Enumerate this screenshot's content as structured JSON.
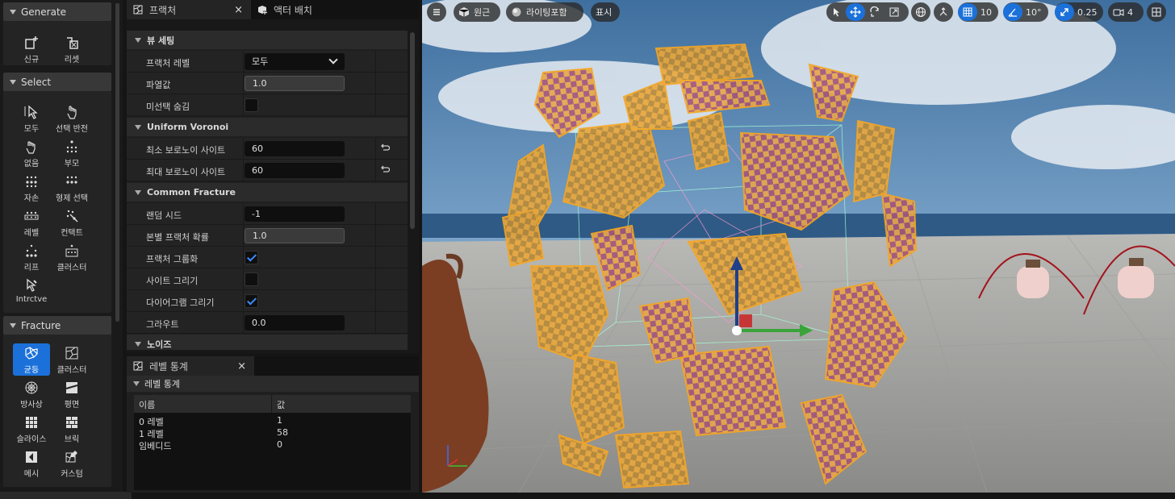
{
  "palette": {
    "sections": [
      {
        "title": "Generate",
        "tools": [
          {
            "label": "신규",
            "icon": "new-icon"
          },
          {
            "label": "리셋",
            "icon": "reset-icon"
          }
        ]
      },
      {
        "title": "Select",
        "tools": [
          {
            "label": "모두",
            "icon": "select-all-icon"
          },
          {
            "label": "선택 반전",
            "icon": "invert-selection-icon"
          },
          {
            "label": "없음",
            "icon": "select-none-icon"
          },
          {
            "label": "부모",
            "icon": "parent-icon"
          },
          {
            "label": "자손",
            "icon": "children-icon"
          },
          {
            "label": "형제 선택",
            "icon": "siblings-icon"
          },
          {
            "label": "레벨",
            "icon": "level-icon"
          },
          {
            "label": "컨택트",
            "icon": "contact-icon"
          },
          {
            "label": "리프",
            "icon": "leaf-icon"
          },
          {
            "label": "클러스터",
            "icon": "cluster-icon"
          },
          {
            "label": "Intrctve",
            "icon": "interactive-icon"
          }
        ]
      },
      {
        "title": "Fracture",
        "tools": [
          {
            "label": "균등",
            "icon": "uniform-icon",
            "active": true
          },
          {
            "label": "클러스터",
            "icon": "cluster-fracture-icon"
          },
          {
            "label": "방사상",
            "icon": "radial-icon"
          },
          {
            "label": "평면",
            "icon": "planar-icon"
          },
          {
            "label": "슬라이스",
            "icon": "slice-icon"
          },
          {
            "label": "브릭",
            "icon": "brick-icon"
          },
          {
            "label": "메시",
            "icon": "mesh-icon"
          },
          {
            "label": "커스텀",
            "icon": "custom-icon"
          }
        ]
      }
    ]
  },
  "details": {
    "tabs": [
      {
        "label": "프랙처",
        "icon": "fracture-tab-icon",
        "active": true
      },
      {
        "label": "액터 배치",
        "icon": "place-actors-icon",
        "active": false
      }
    ],
    "close": "×",
    "categories": {
      "view": "뷰 세팅",
      "voronoi": "Uniform Voronoi",
      "common": "Common Fracture",
      "noise": "노이즈"
    },
    "rows": {
      "fracture_level": {
        "label": "프랙처 레벨",
        "value": "모두"
      },
      "explode": {
        "label": "파열값",
        "value": "1.0"
      },
      "hide_unselected": {
        "label": "미선택 숨김",
        "checked": false
      },
      "min_sites": {
        "label": "최소 보로노이 사이트",
        "value": "60"
      },
      "max_sites": {
        "label": "최대 보로노이 사이트",
        "value": "60"
      },
      "random_seed": {
        "label": "랜덤 시드",
        "value": "-1"
      },
      "chance": {
        "label": "본별 프랙처 확률",
        "value": "1.0"
      },
      "group_fracture": {
        "label": "프랙처 그룹화",
        "checked": true
      },
      "draw_sites": {
        "label": "사이트 그리기",
        "checked": false
      },
      "draw_diagram": {
        "label": "다이어그램 그리기",
        "checked": true
      },
      "grout": {
        "label": "그라우트",
        "value": "0.0"
      }
    }
  },
  "stats": {
    "tab": "레벨 통계",
    "close": "×",
    "category": "레벨 통계",
    "headers": {
      "name": "이름",
      "value": "값"
    },
    "rows": [
      {
        "name": "0 레벨",
        "value": "1"
      },
      {
        "name": "1 레벨",
        "value": "58"
      },
      {
        "name": "임베디드",
        "value": "0"
      }
    ]
  },
  "viewport": {
    "menu_icon": "hamburger-icon",
    "perspective": "원근",
    "lighting": "라이팅포함",
    "show": "표시",
    "grid_snap": "10",
    "rotate_snap": "10°",
    "scale_snap": "0.25",
    "camera_speed": "4",
    "colors": {
      "accent": "#1b71d9",
      "fragment": "#e8a63a",
      "sky": "#4f7fb0"
    }
  }
}
